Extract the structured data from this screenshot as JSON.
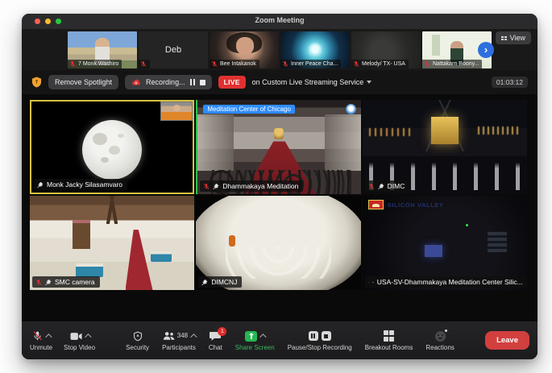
{
  "window": {
    "title": "Zoom Meeting"
  },
  "filmstrip": {
    "thumbnails": [
      {
        "name": "7 Monk Washiro",
        "muted": true
      },
      {
        "name": "",
        "center_text": "Deb",
        "muted": true
      },
      {
        "name": "Bee Intakanok",
        "muted": true
      },
      {
        "name": "Inner Peace Cha...",
        "muted": true
      },
      {
        "name": "Melody/ TX- USA",
        "muted": true
      },
      {
        "name": "Nattakarn Boony...",
        "muted": true
      }
    ],
    "next_button": "›",
    "view_button": "View"
  },
  "controlbar": {
    "remove_spotlight": "Remove Spotlight",
    "recording_label": "Recording...",
    "live_badge": "LIVE",
    "live_destination": "on Custom Live Streaming Service",
    "timer": "01:03:12"
  },
  "grid": {
    "tiles": [
      {
        "name": "Monk Jacky Silasamvaro",
        "muted": false,
        "pinned": true,
        "border": "yellow"
      },
      {
        "name": "Dhammakaya Meditation",
        "muted": true,
        "pinned": true,
        "overlay_label": "Meditation Center of Chicago",
        "border": "green-left"
      },
      {
        "name": "DIMC",
        "muted": true,
        "pinned": true
      },
      {
        "name": "SMC camera",
        "muted": true,
        "pinned": true
      },
      {
        "name": "DIMCNJ",
        "muted": false,
        "pinned": true
      },
      {
        "name": "USA-SV-Dhammakaya Meditation Center Silic...",
        "muted": true,
        "pinned": true,
        "overlay_logo_text": "SILICON VALLEY"
      }
    ]
  },
  "toolbar": {
    "unmute": "Unmute",
    "stop_video": "Stop Video",
    "security": "Security",
    "participants": "Participants",
    "participants_count": "348",
    "chat": "Chat",
    "chat_badge": "1",
    "share_screen": "Share Screen",
    "pause_stop_recording": "Pause/Stop Recording",
    "breakout_rooms": "Breakout Rooms",
    "reactions": "Reactions",
    "leave": "Leave"
  },
  "colors": {
    "accent_blue": "#2d8cff",
    "live_red": "#e03131",
    "leave_red": "#d23f3f",
    "share_green": "#26b753",
    "active_border_yellow": "#d8c23e",
    "active_border_green": "#30c14e",
    "mute_red": "#e03131"
  }
}
